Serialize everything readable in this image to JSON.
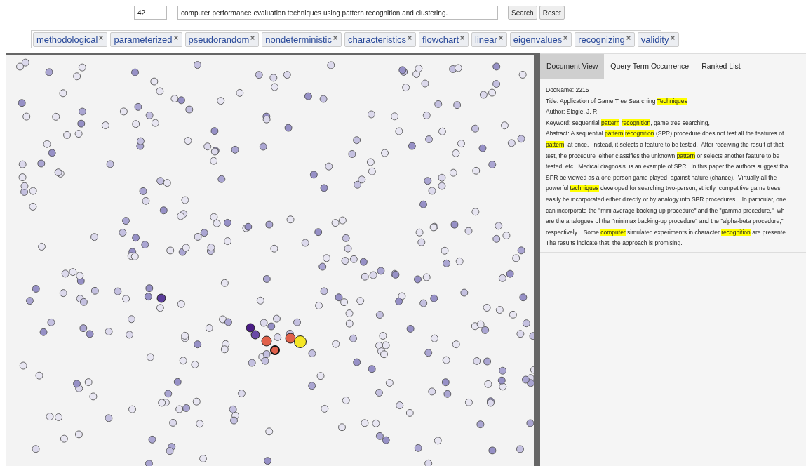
{
  "query_bar": {
    "topic_id": "42",
    "query": "computer performance evaluation techniques using pattern recognition and clustering.",
    "buttons": [
      "Search",
      "Reset"
    ]
  },
  "terms": [
    "methodological",
    "parameterized",
    "pseudorandom",
    "nondeterministic",
    "characteristics",
    "flowchart",
    "linear",
    "eigenvalues",
    "recognizing",
    "validity"
  ],
  "tabs": [
    {
      "label": "Document View",
      "selected": true
    },
    {
      "label": "Query Term Occurrence",
      "selected": false
    },
    {
      "label": "Ranked List",
      "selected": false
    }
  ],
  "document": {
    "lines": [
      [
        {
          "text": "DocName: 2215",
          "highlight": false
        }
      ],
      [
        {
          "text": "Title: Application of Game Tree Searching ",
          "highlight": false
        },
        {
          "text": "Techniques",
          "highlight": true
        }
      ],
      [
        {
          "text": "Author: Slagle, J. R.",
          "highlight": false
        }
      ],
      [
        {
          "text": "Keyword: sequential ",
          "highlight": false
        },
        {
          "text": "pattern recognition",
          "highlight": true
        },
        {
          "text": ", game tree searching,",
          "highlight": false
        }
      ],
      [
        {
          "text": "Abstract: A sequential ",
          "highlight": false
        },
        {
          "text": "pattern recognition",
          "highlight": true
        },
        {
          "text": " (SPR) procedure does not test all the features of",
          "highlight": false
        }
      ],
      [
        {
          "text": "pattern",
          "highlight": true
        },
        {
          "text": "  at once.  Instead, it selects a feature to be tested.  After receiving the result of that",
          "highlight": false
        }
      ],
      [
        {
          "text": "test, the procedure  either classifies the unknown ",
          "highlight": false
        },
        {
          "text": "pattern",
          "highlight": true
        },
        {
          "text": " or selects another feature to be",
          "highlight": false
        }
      ],
      [
        {
          "text": "tested, etc.  Medical diagnosis  is an example of SPR.  In this paper the authors suggest tha",
          "highlight": false
        }
      ],
      [
        {
          "text": "SPR be viewed as a one-person game played  against nature (chance).  Virtually all the",
          "highlight": false
        }
      ],
      [
        {
          "text": "powerful ",
          "highlight": false
        },
        {
          "text": "techniques",
          "highlight": true
        },
        {
          "text": " developed for searching two-person, strictly  competitive game trees",
          "highlight": false
        }
      ],
      [
        {
          "text": "easily be incorporated either directly or by analogy into SPR procedures.   In particular, one",
          "highlight": false
        }
      ],
      [
        {
          "text": "can incorporate the \"mini average backing-up procedure\" and the \"gamma procedure,\"  wh",
          "highlight": false
        }
      ],
      [
        {
          "text": "are the analogues of the \"minimax backing-up procedure\" and the \"alpha-beta procedure,\"",
          "highlight": false
        }
      ],
      [
        {
          "text": "respectively.   Some ",
          "highlight": false
        },
        {
          "text": "computer",
          "highlight": true
        },
        {
          "text": " simulated experiments in character ",
          "highlight": false
        },
        {
          "text": "recognition",
          "highlight": true
        },
        {
          "text": " are presente",
          "highlight": false
        }
      ],
      [
        {
          "text": "The results indicate that  the approach is promising.",
          "highlight": false
        }
      ]
    ]
  }
}
